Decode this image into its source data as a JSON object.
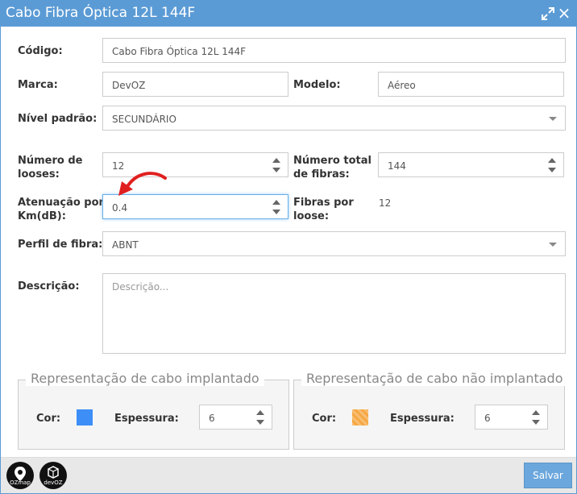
{
  "window": {
    "title": "Cabo Fibra Óptica 12L 144F"
  },
  "form": {
    "codigo": {
      "label": "Código:",
      "value": "Cabo Fibra Óptica 12L 144F"
    },
    "marca": {
      "label": "Marca:",
      "value": "DevOZ"
    },
    "modelo": {
      "label": "Modelo:",
      "value": "Aéreo"
    },
    "nivel": {
      "label": "Nível padrão:",
      "value": "SECUNDÁRIO"
    },
    "numero_looses": {
      "label_line1": "Número de",
      "label_line2": "looses:",
      "value": "12"
    },
    "numero_fibras": {
      "label_line1": "Número total",
      "label_line2": "de fibras:",
      "value": "144"
    },
    "atenuacao": {
      "label_line1": "Atenuação por",
      "label_line2": "Km(dB):",
      "value": "0.4"
    },
    "fibras_por_loose": {
      "label_line1": "Fibras por",
      "label_line2": "loose:",
      "value": "12"
    },
    "perfil": {
      "label": "Perfil de fibra:",
      "value": "ABNT"
    },
    "descricao": {
      "label": "Descrição:",
      "placeholder": "Descrição..."
    }
  },
  "implantado": {
    "legend": "Representação de cabo implantado",
    "cor_label": "Cor:",
    "color": "#3d8ef7",
    "espessura_label": "Espessura:",
    "espessura_value": "6"
  },
  "nao_implantado": {
    "legend": "Representação de cabo não implantado",
    "cor_label": "Cor:",
    "color": "#f5a742",
    "espessura_label": "Espessura:",
    "espessura_value": "6"
  },
  "footer": {
    "logo1_text": "OZmap",
    "logo2_text": "devOZ",
    "save_label": "Salvar"
  },
  "icons": {
    "maximize": "maximize-icon",
    "close": "close-icon",
    "annotation_arrow": "red-arrow-icon"
  }
}
